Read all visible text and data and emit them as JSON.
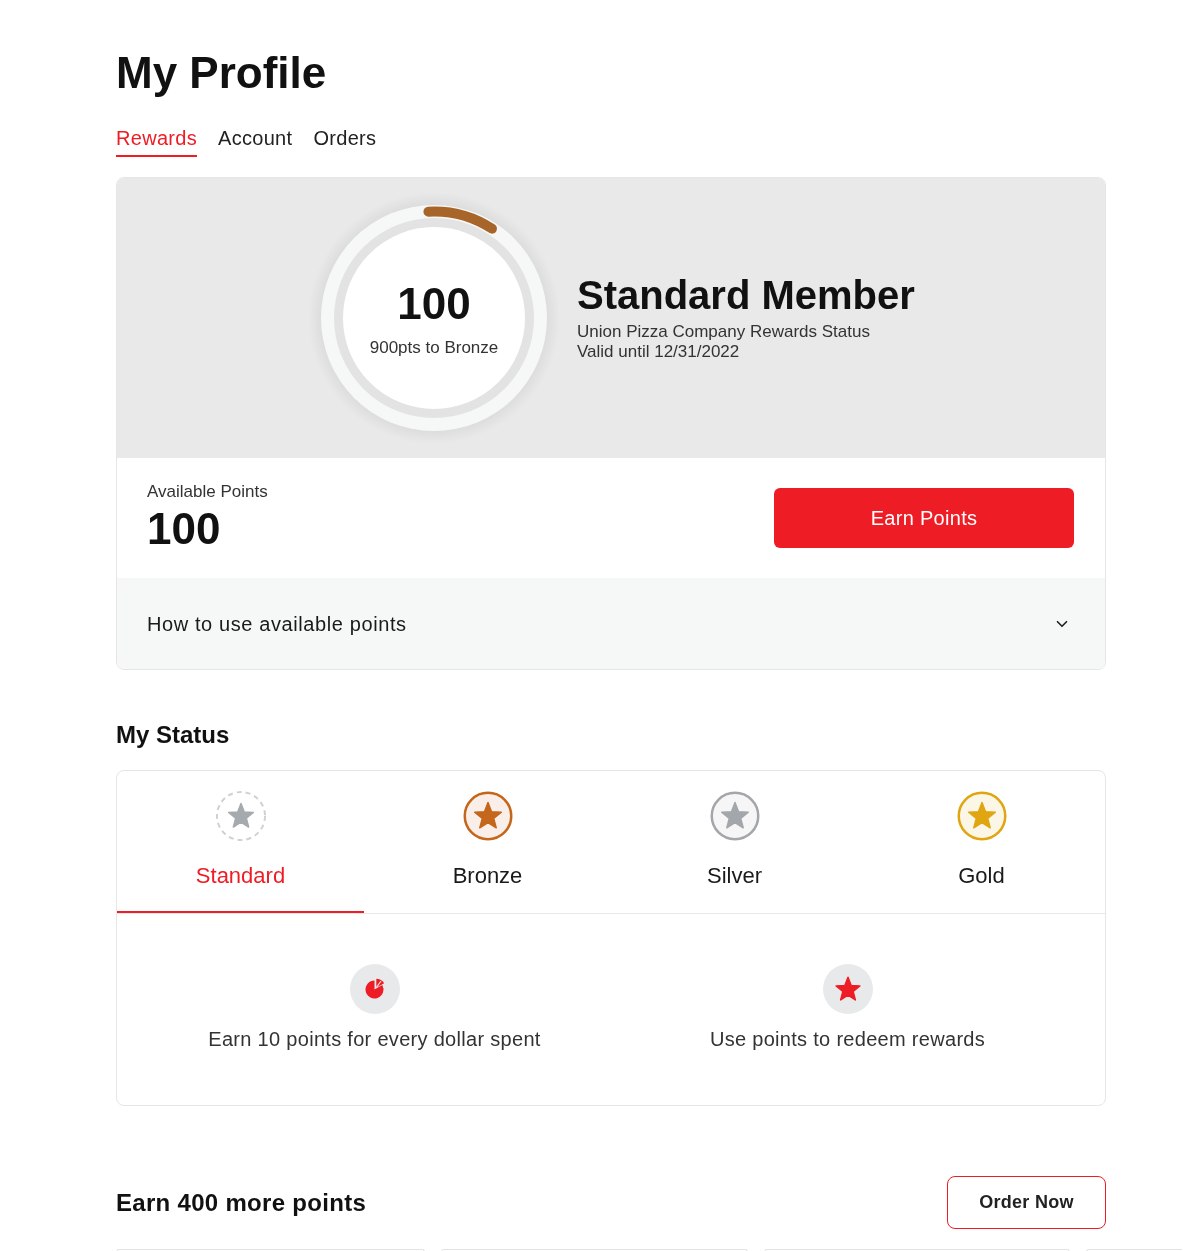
{
  "page": {
    "title": "My Profile"
  },
  "tabs": [
    {
      "label": "Rewards",
      "selected": true
    },
    {
      "label": "Account",
      "selected": false
    },
    {
      "label": "Orders",
      "selected": false
    }
  ],
  "rewards_card": {
    "progress": {
      "value": "100",
      "caption": "900pts to Bronze",
      "level": 0.1
    },
    "status": {
      "title": "Standard Member",
      "lines": [
        "Union Pizza Company Rewards Status",
        "Valid until 12/31/2022"
      ]
    },
    "available_points": {
      "label": "Available Points",
      "value": "100"
    },
    "earn_button": "Earn Points",
    "accordion": {
      "label": "How to use available points",
      "expanded": false
    }
  },
  "my_status": {
    "heading": "My Status",
    "tiers": [
      {
        "label": "Standard",
        "kind": "placeholder",
        "color": "#a5aaae",
        "selected": true
      },
      {
        "label": "Bronze",
        "kind": "medal",
        "color": "#c4661c",
        "selected": false
      },
      {
        "label": "Silver",
        "kind": "medal",
        "color": "#a3a7ab",
        "selected": false
      },
      {
        "label": "Gold",
        "kind": "medal",
        "color": "#e0a612",
        "selected": false
      }
    ],
    "benefits": [
      {
        "kind": "earn",
        "text": "Earn 10 points for every dollar spent"
      },
      {
        "kind": "redeem",
        "text": "Use points to redeem rewards"
      }
    ]
  },
  "earn_more": {
    "heading": "Earn 400 more points",
    "button": "Order Now"
  }
}
